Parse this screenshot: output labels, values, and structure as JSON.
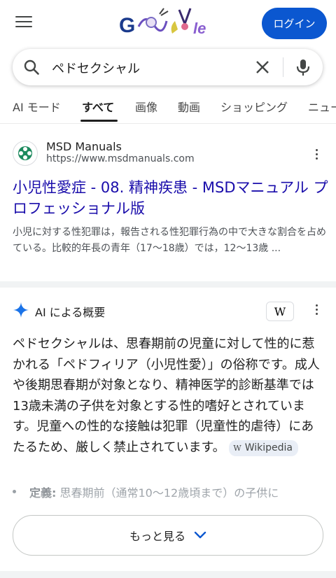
{
  "header": {
    "login_label": "ログイン"
  },
  "search": {
    "query": "ペドセクシャル"
  },
  "tabs": [
    {
      "label": "AI モード"
    },
    {
      "label": "すべて",
      "active": true
    },
    {
      "label": "画像"
    },
    {
      "label": "動画"
    },
    {
      "label": "ショッピング"
    },
    {
      "label": "ニュース"
    }
  ],
  "result": {
    "site_name": "MSD Manuals",
    "url": "https://www.msdmanuals.com",
    "title": "小児性愛症 - 08. 精神疾患 - MSDマニュアル プロフェッショナル版",
    "snippet": "小児に対する性犯罪は，報告される性犯罪行為の中で大きな割合を占めている。比較的年長の青年（17〜18歳）では，12〜13歳 ..."
  },
  "ai_overview": {
    "title": "AI による概要",
    "source_logo": "W",
    "body": "ペドセクシャルは、思春期前の児童に対して性的に惹かれる「ペドフィリア（小児性愛）」の俗称です。成人や後期思春期が対象となり、精神医学的診断基準では13歳未満の子供を対象とする性的嗜好とされています。児童への性的な接触は犯罪（児童性的虐待）にあたるため、厳しく禁止されています。",
    "citation": "Wikipedia",
    "bullet_term": "定義:",
    "bullet_text": "思春期前（通常10〜12歳頃まで）の子供に",
    "more_label": "もっと見る"
  },
  "colors": {
    "accent": "#0b57d0",
    "link": "#1a0dab"
  }
}
